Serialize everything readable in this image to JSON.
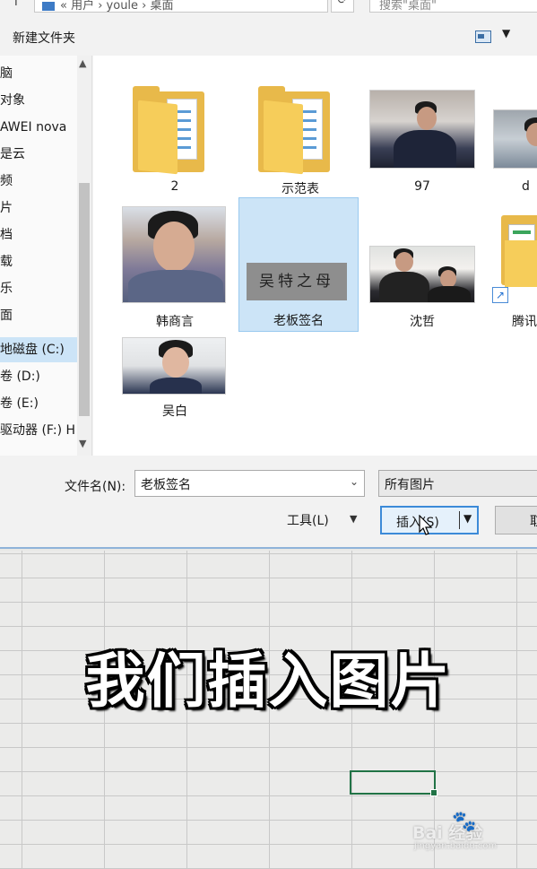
{
  "dialog": {
    "address_path": "« 用户 › youle › 桌面",
    "search_placeholder": "搜索\"桌面\"",
    "toolbar": {
      "new_folder": "新建文件夹"
    },
    "nav_items": [
      {
        "label": "脑",
        "selected": false
      },
      {
        "label": "对象",
        "selected": false
      },
      {
        "label": "AWEI nova",
        "selected": false
      },
      {
        "label": "是云",
        "selected": false
      },
      {
        "label": "频",
        "selected": false
      },
      {
        "label": "片",
        "selected": false
      },
      {
        "label": "档",
        "selected": false
      },
      {
        "label": "载",
        "selected": false
      },
      {
        "label": "乐",
        "selected": false
      },
      {
        "label": "面",
        "selected": false
      },
      {
        "label": "地磁盘 (C:)",
        "selected": true
      },
      {
        "label": "卷 (D:)",
        "selected": false
      },
      {
        "label": "卷 (E:)",
        "selected": false
      },
      {
        "label": "驱动器 (F:) H",
        "selected": false
      }
    ],
    "files": [
      {
        "name": "2",
        "kind": "folder"
      },
      {
        "name": "示范表",
        "kind": "folder"
      },
      {
        "name": "97",
        "kind": "photo"
      },
      {
        "name": "d",
        "kind": "photo"
      },
      {
        "name": "韩商言",
        "kind": "photo"
      },
      {
        "name": "老板签名",
        "kind": "photo",
        "selected": true,
        "image_text": "吴特之母"
      },
      {
        "name": "沈哲",
        "kind": "photo"
      },
      {
        "name": "腾讯",
        "kind": "shortcut"
      },
      {
        "name": "吴白",
        "kind": "photo"
      }
    ],
    "filename_label": "文件名(N):",
    "filename_value": "老板签名",
    "filetype_value": "所有图片",
    "tools_label": "工具(L)",
    "insert_label": "插入(S)",
    "cancel_label": "取"
  },
  "sheet": {
    "caption": "我们插入图片"
  },
  "watermark": {
    "brand": "Bai  经验",
    "url": "jingyan.baidu.com"
  },
  "colors": {
    "selection": "#cce4f7",
    "insert_border": "#3c8ad8",
    "excel_green": "#217346"
  }
}
